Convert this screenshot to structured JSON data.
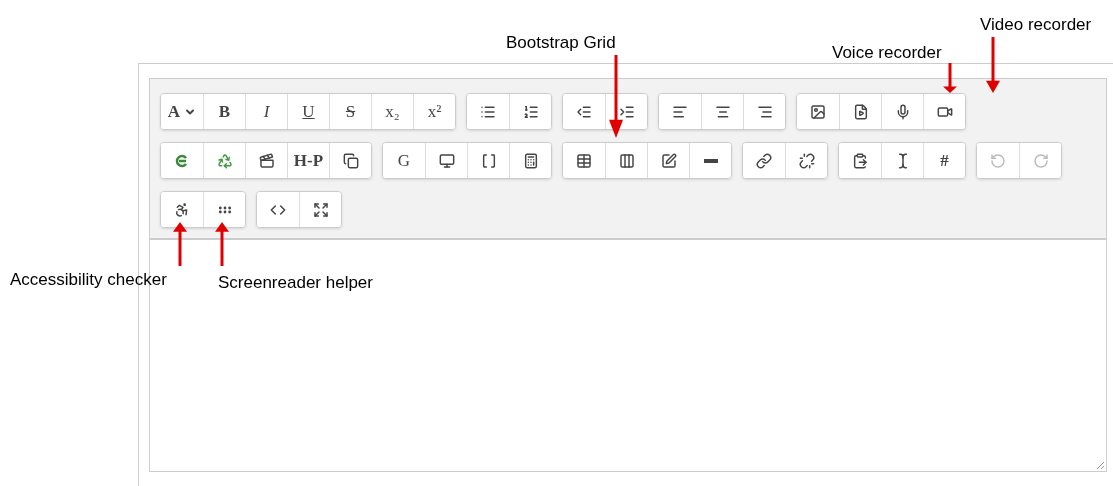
{
  "annotations": [
    {
      "kind": "above",
      "label": "Bootstrap Grid"
    },
    {
      "kind": "above",
      "label": "Voice recorder"
    },
    {
      "kind": "above",
      "label": "Video recorder"
    },
    {
      "kind": "below",
      "label": "Accessibility checker"
    },
    {
      "kind": "below",
      "label": "Screenreader helper"
    }
  ],
  "toolbar": {
    "rows": [
      [
        [
          {
            "glyph": "A",
            "disabled": false
          },
          {
            "glyph": "B",
            "disabled": false
          },
          {
            "glyph": "I",
            "disabled": false
          },
          {
            "glyph": "U",
            "disabled": false
          },
          {
            "glyph": "S",
            "disabled": false
          },
          {
            "glyph": "x₂",
            "disabled": false
          },
          {
            "glyph": "x²",
            "disabled": false
          }
        ],
        [
          {
            "disabled": false
          },
          {
            "disabled": false
          }
        ],
        [
          {
            "disabled": false
          },
          {
            "disabled": false
          }
        ],
        [
          {
            "disabled": false
          },
          {
            "disabled": false
          },
          {
            "disabled": false
          }
        ],
        [
          {
            "disabled": false
          },
          {
            "disabled": false
          },
          {
            "disabled": false
          },
          {
            "disabled": false
          }
        ]
      ],
      [
        [
          {
            "disabled": false
          },
          {
            "disabled": false
          },
          {
            "disabled": false
          },
          {
            "glyph": "H-P",
            "disabled": false
          },
          {
            "disabled": false
          }
        ],
        [
          {
            "glyph": "G",
            "disabled": false
          },
          {
            "disabled": false
          },
          {
            "disabled": false
          },
          {
            "disabled": false
          }
        ],
        [
          {
            "disabled": false
          },
          {
            "disabled": false
          },
          {
            "disabled": false
          },
          {
            "disabled": false
          }
        ],
        [
          {
            "disabled": false
          },
          {
            "disabled": false
          }
        ],
        [
          {
            "disabled": false
          },
          {
            "disabled": false
          },
          {
            "glyph": "#",
            "disabled": false
          }
        ],
        [
          {
            "disabled": true
          },
          {
            "disabled": true
          }
        ]
      ],
      [
        [
          {
            "disabled": false
          },
          {
            "disabled": false
          }
        ],
        [
          {
            "disabled": false
          },
          {
            "disabled": false
          }
        ]
      ]
    ]
  }
}
